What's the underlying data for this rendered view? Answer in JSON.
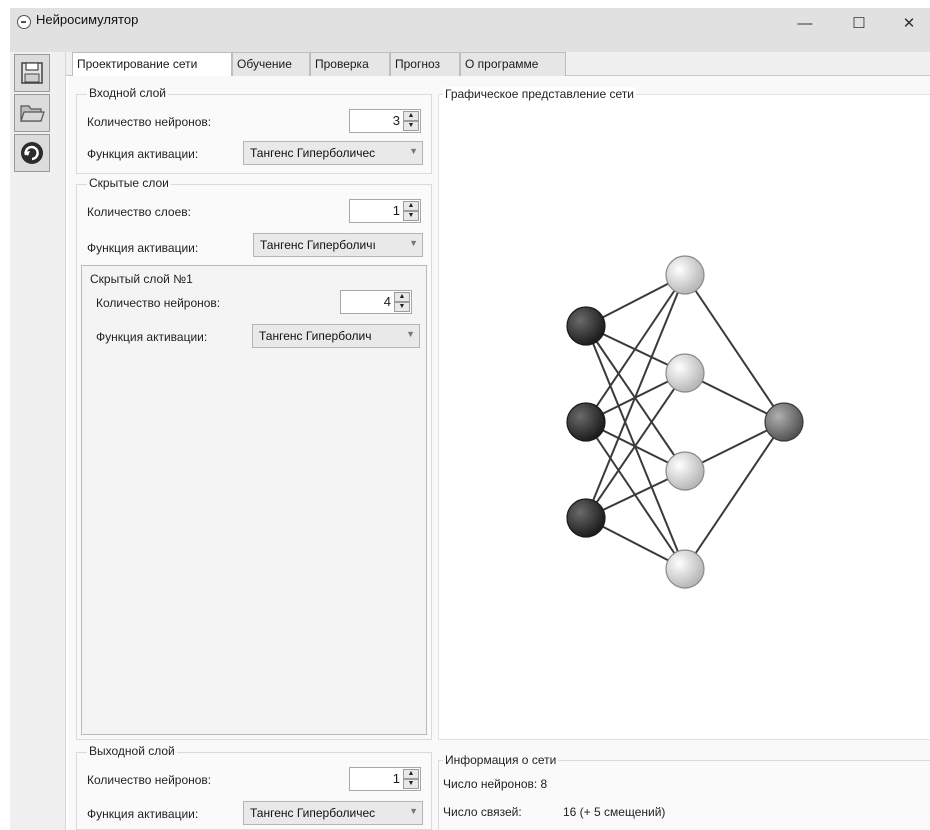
{
  "window": {
    "title": "Нейросимулятор",
    "minimize": "—",
    "maximize": "☐",
    "close": "✕"
  },
  "toolbar": {
    "icons": [
      "floppy-save-icon",
      "folder-open-icon",
      "refresh-icon"
    ]
  },
  "tabs": [
    {
      "label": "Проектирование сети",
      "active": true
    },
    {
      "label": "Обучение",
      "active": false
    },
    {
      "label": "Проверка",
      "active": false
    },
    {
      "label": "Прогноз",
      "active": false
    },
    {
      "label": "О программе",
      "active": false
    }
  ],
  "input_layer": {
    "title": "Входной слой",
    "neurons_label": "Количество нейронов:",
    "neurons_value": "3",
    "activation_label": "Функция активации:",
    "activation_value": "Тангенс Гиперболичес"
  },
  "hidden_layers": {
    "title": "Скрытые слои",
    "count_label": "Количество слоев:",
    "count_value": "1",
    "activation_label": "Функция активации:",
    "activation_value": "Тангенс Гиперболичı",
    "layer1": {
      "title": "Скрытый слой №1",
      "neurons_label": "Количество нейронов:",
      "neurons_value": "4",
      "activation_label": "Функция активации:",
      "activation_value": "Тангенс Гиперболич"
    }
  },
  "output_layer": {
    "title": "Выходной слой",
    "neurons_label": "Количество нейронов:",
    "neurons_value": "1",
    "activation_label": "Функция активации:",
    "activation_value": "Тангенс Гиперболичес"
  },
  "graph": {
    "title": "Графическое представление сети",
    "layers": [
      3,
      4,
      1
    ]
  },
  "info": {
    "title": "Информация о сети",
    "neurons_text": "Число нейронов: 8",
    "links_label": "Число связей:",
    "links_value": "16 (+ 5 смещений)"
  },
  "colors": {
    "input_neuron": "#2e2e2e",
    "hidden_neuron": "#e6e6e6",
    "output_neuron": "#7a7a7a",
    "edge": "#3a3a3a"
  }
}
